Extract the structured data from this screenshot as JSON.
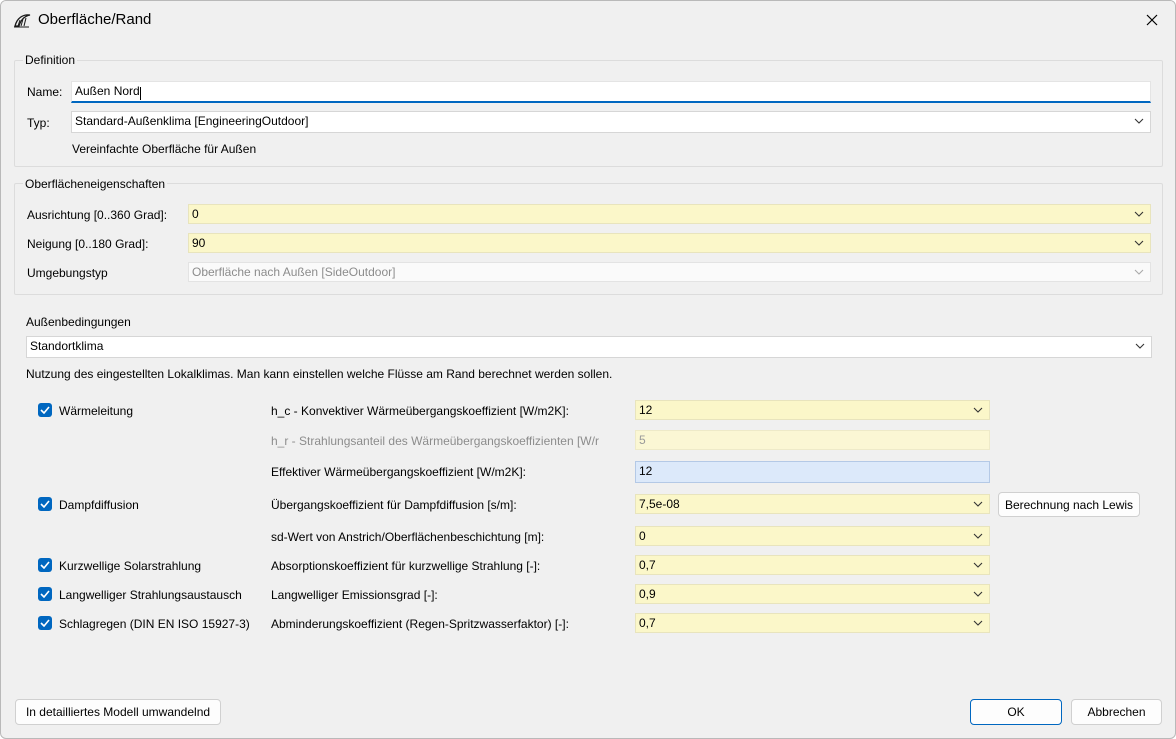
{
  "window": {
    "title": "Oberfläche/Rand"
  },
  "definition": {
    "group_title": "Definition",
    "name_label": "Name:",
    "name_value": "Außen Nord",
    "type_label": "Typ:",
    "type_value": "Standard-Außenklima [EngineeringOutdoor]",
    "type_description": "Vereinfachte Oberfläche für Außen"
  },
  "surface": {
    "group_title": "Oberflächeneigenschaften",
    "orientation_label": "Ausrichtung [0..360 Grad]:",
    "orientation_value": "0",
    "inclination_label": "Neigung [0..180 Grad]:",
    "inclination_value": "90",
    "environment_label": "Umgebungstyp",
    "environment_value": "Oberfläche nach Außen [SideOutdoor]"
  },
  "outdoor": {
    "section_title": "Außenbedingungen",
    "climate_value": "Standortklima",
    "description": "Nutzung des eingestellten Lokalklimas. Man kann einstellen welche Flüsse am Rand berechnet werden sollen."
  },
  "fluxes": {
    "heat": {
      "checkbox_label": "Wärmeleitung",
      "checked": true,
      "hc_label": "h_c - Konvektiver Wärmeübergangskoeffizient [W/m2K]:",
      "hc_value": "12",
      "hr_label": "h_r - Strahlungsanteil des Wärmeübergangskoeffizienten [W/r",
      "hr_value": "5",
      "eff_label": "Effektiver Wärmeübergangskoeffizient [W/m2K]:",
      "eff_value": "12"
    },
    "vapor": {
      "checkbox_label": "Dampfdiffusion",
      "checked": true,
      "coef_label": "Übergangskoeffizient für Dampfdiffusion [s/m]:",
      "coef_value": "7,5e-08",
      "lewis_button": "Berechnung nach Lewis",
      "sd_label": "sd-Wert von Anstrich/Oberflächenbeschichtung [m]:",
      "sd_value": "0"
    },
    "solar": {
      "checkbox_label": "Kurzwellige Solarstrahlung",
      "checked": true,
      "label": "Absorptionskoeffizient für kurzwellige Strahlung [-]:",
      "value": "0,7"
    },
    "longwave": {
      "checkbox_label": "Langwelliger Strahlungsaustausch",
      "checked": true,
      "label": "Langwelliger Emissionsgrad [-]:",
      "value": "0,9"
    },
    "rain": {
      "checkbox_label": "Schlagregen (DIN EN ISO 15927-3)",
      "checked": true,
      "label": "Abminderungskoeffizient (Regen-Spritzwasserfaktor) [-]:",
      "value": "0,7"
    }
  },
  "buttons": {
    "convert": "In detailliertes Modell umwandelnd",
    "ok": "OK",
    "cancel": "Abbrechen"
  }
}
